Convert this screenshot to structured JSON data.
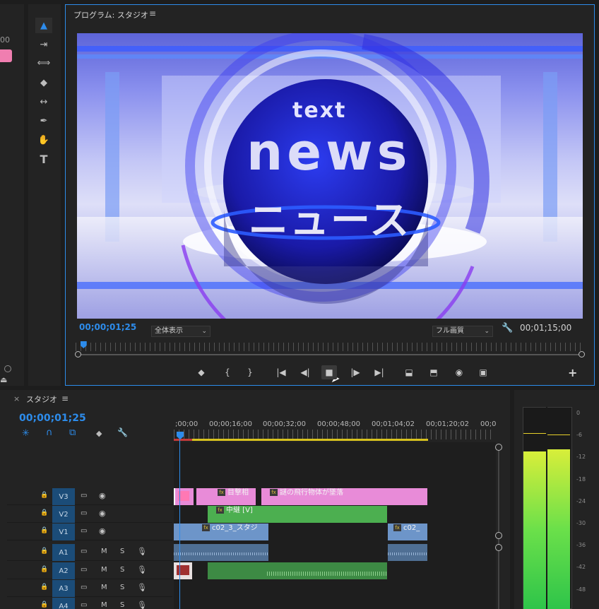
{
  "left_panel": {
    "timecode_frag": "00"
  },
  "tools": [
    {
      "name": "selection-tool-icon",
      "glyph": "▲"
    },
    {
      "name": "track-select-tool-icon",
      "glyph": "⇥"
    },
    {
      "name": "ripple-edit-tool-icon",
      "glyph": "⟺"
    },
    {
      "name": "razor-tool-icon",
      "glyph": "◆"
    },
    {
      "name": "slip-tool-icon",
      "glyph": "↔"
    },
    {
      "name": "pen-tool-icon",
      "glyph": "✒"
    },
    {
      "name": "hand-tool-icon",
      "glyph": "✋"
    },
    {
      "name": "type-tool-icon",
      "glyph": "T"
    }
  ],
  "program": {
    "title": "プログラム: スタジオ",
    "menu_glyph": "≡",
    "video_text_small": "text",
    "video_text_big": "news",
    "video_text_jp": "ニュース",
    "timecode": "00;00;01;25",
    "zoom": "全体表示",
    "quality": "フル画質",
    "duration": "00;01;15;00",
    "playhead_fraction": 0.015,
    "controls": [
      "◆",
      "{",
      "}",
      "|◀",
      "◀|",
      "■",
      "|▶",
      "▶|",
      "⬓",
      "⬒",
      "◉",
      "▣"
    ],
    "add_glyph": "+"
  },
  "timeline": {
    "tab_close": "×",
    "tab_label": "スタジオ",
    "menu_glyph": "≡",
    "timecode": "00;00;01;25",
    "ruler": [
      ";00;00",
      "00;00;16;00",
      "00;00;32;00",
      "00;00;48;00",
      "00;01;04;02",
      "00;01;20;02",
      "00;0"
    ],
    "tracks": [
      {
        "id": "V3",
        "type": "video"
      },
      {
        "id": "V2",
        "type": "video"
      },
      {
        "id": "V1",
        "type": "video"
      },
      {
        "id": "A1",
        "type": "audio"
      },
      {
        "id": "A2",
        "type": "audio"
      },
      {
        "id": "A3",
        "type": "audio"
      },
      {
        "id": "A4",
        "type": "audio"
      }
    ],
    "track_icons": {
      "lock": "🔒",
      "film": "▭",
      "eye": "👁",
      "mute": "M",
      "solo": "S",
      "mic": "🎙"
    },
    "clips": {
      "v3_a": "目撃相",
      "v3_b": "謎の飛行物体が墜落",
      "v2": "中継 [V]",
      "v1_a": "c02_3_スタジ",
      "v1_b": "c02_",
      "fx": "fx"
    }
  },
  "meter": {
    "labels": [
      "0",
      "-6",
      "-12",
      "-18",
      "-24",
      "-30",
      "-36",
      "-42",
      "-48"
    ],
    "level_left": 0.78,
    "level_right": 0.79
  }
}
